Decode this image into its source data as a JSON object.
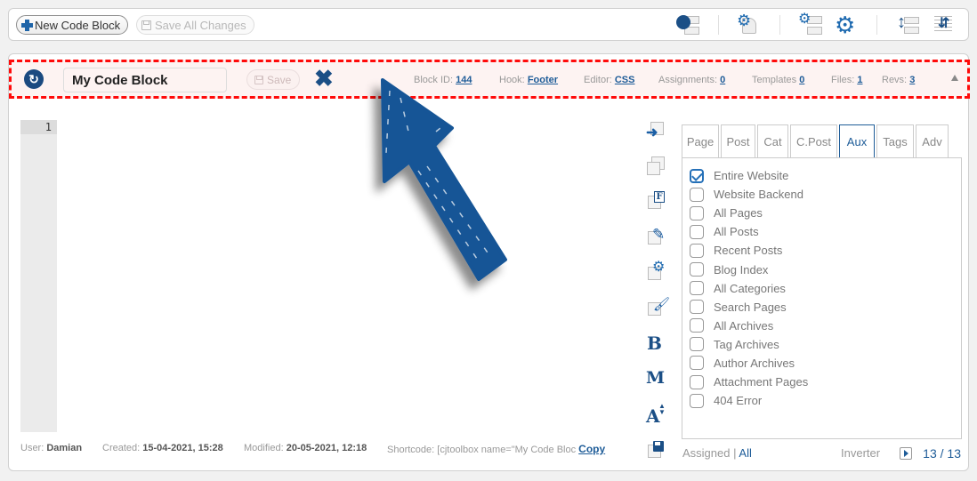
{
  "toolbar": {
    "new_block_label": "New Code Block",
    "save_all_label": "Save All Changes",
    "right_icons": [
      "revisions-list-icon",
      "settings-page-icon",
      "blocks-settings-icon",
      "gear-icon",
      "expand-all-icon",
      "collapse-all-icon"
    ]
  },
  "block": {
    "name": "My Code Block",
    "save_label": "Save",
    "meta": {
      "block_id_label": "Block ID:",
      "block_id": "144",
      "hook_label": "Hook:",
      "hook": "Footer",
      "editor_label": "Editor:",
      "editor": "CSS",
      "assignments_label": "Assignments:",
      "assignments": "0",
      "templates_label": "Templates",
      "templates": "0",
      "files_label": "Files:",
      "files": "1",
      "revs_label": "Revs:",
      "revs": "3"
    }
  },
  "editor": {
    "line_numbers": [
      "1"
    ],
    "content": ""
  },
  "tools": [
    "insert-icon",
    "copy-icon",
    "format-icon",
    "edit-icon",
    "settings-icon",
    "style-brush-icon",
    "bold-icon",
    "minify-icon",
    "font-size-icon",
    "save-icon"
  ],
  "tool_letters": {
    "bold": "B",
    "minify": "M",
    "font": "A"
  },
  "assign": {
    "tabs": [
      {
        "label": "Page",
        "active": false
      },
      {
        "label": "Post",
        "active": false
      },
      {
        "label": "Cat",
        "active": false
      },
      {
        "label": "C.Post",
        "active": false
      },
      {
        "label": "Aux",
        "active": true
      },
      {
        "label": "Tags",
        "active": false
      },
      {
        "label": "Adv",
        "active": false
      }
    ],
    "items": [
      {
        "label": "Entire Website",
        "checked": true
      },
      {
        "label": "Website Backend",
        "checked": false
      },
      {
        "label": "All Pages",
        "checked": false
      },
      {
        "label": "All Posts",
        "checked": false
      },
      {
        "label": "Recent Posts",
        "checked": false
      },
      {
        "label": "Blog Index",
        "checked": false
      },
      {
        "label": "All Categories",
        "checked": false
      },
      {
        "label": "Search Pages",
        "checked": false
      },
      {
        "label": "All Archives",
        "checked": false
      },
      {
        "label": "Tag Archives",
        "checked": false
      },
      {
        "label": "Author Archives",
        "checked": false
      },
      {
        "label": "Attachment Pages",
        "checked": false
      },
      {
        "label": "404 Error",
        "checked": false
      }
    ],
    "footer": {
      "assigned_label": "Assigned",
      "separator": "|",
      "all_label": "All",
      "inverter_label": "Inverter",
      "count": "13 / 13"
    }
  },
  "footer": {
    "user_label": "User:",
    "user": "Damian",
    "created_label": "Created:",
    "created": "15-04-2021, 15:28",
    "modified_label": "Modified:",
    "modified": "20-05-2021, 12:18",
    "shortcode_label": "Shortcode:",
    "shortcode": "[cjtoolbox name=\"My Code Bloc",
    "copy_label": "Copy"
  },
  "colors": {
    "accent": "#1e5c98",
    "highlight_border": "#ff0a0a",
    "header_bg": "#fdf3f2",
    "arrow": "#155496"
  }
}
